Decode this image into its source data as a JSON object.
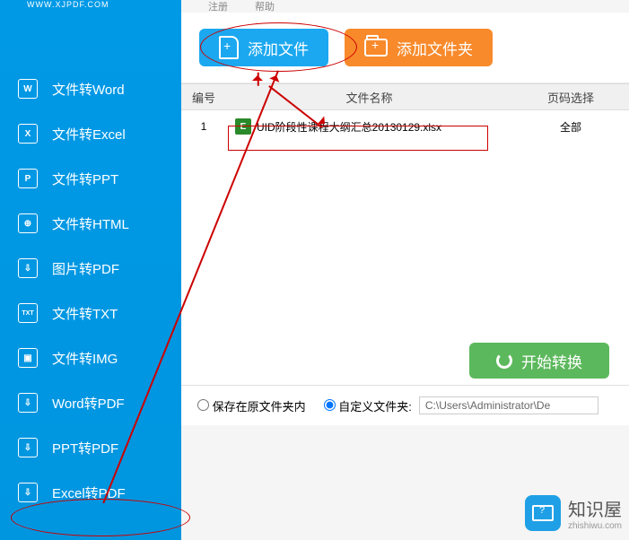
{
  "header": {
    "url": "WWW.XJPDF.COM"
  },
  "menu": {
    "register": "注册",
    "help": "帮助"
  },
  "sidebar": {
    "items": [
      {
        "label": "文件转Word",
        "icon": "W"
      },
      {
        "label": "文件转Excel",
        "icon": "X"
      },
      {
        "label": "文件转PPT",
        "icon": "P"
      },
      {
        "label": "文件转HTML",
        "icon": "⊕"
      },
      {
        "label": "图片转PDF",
        "icon": "⇩"
      },
      {
        "label": "文件转TXT",
        "icon": "TXT"
      },
      {
        "label": "文件转IMG",
        "icon": "▣"
      },
      {
        "label": "Word转PDF",
        "icon": "⇩"
      },
      {
        "label": "PPT转PDF",
        "icon": "⇩"
      },
      {
        "label": "Excel转PDF",
        "icon": "⇩"
      }
    ]
  },
  "toolbar": {
    "add_file": "添加文件",
    "add_folder": "添加文件夹"
  },
  "table": {
    "headers": {
      "no": "编号",
      "name": "文件名称",
      "page": "页码选择"
    },
    "rows": [
      {
        "no": "1",
        "name": "UID阶段性课程大纲汇总20130129.xlsx",
        "page": "全部",
        "icon": "E"
      }
    ]
  },
  "actions": {
    "start": "开始转换"
  },
  "save": {
    "opt_original": "保存在原文件夹内",
    "opt_custom": "自定义文件夹:",
    "path": "C:\\Users\\Administrator\\De"
  },
  "watermark": {
    "title": "知识屋",
    "sub": "zhishiwu.com"
  }
}
